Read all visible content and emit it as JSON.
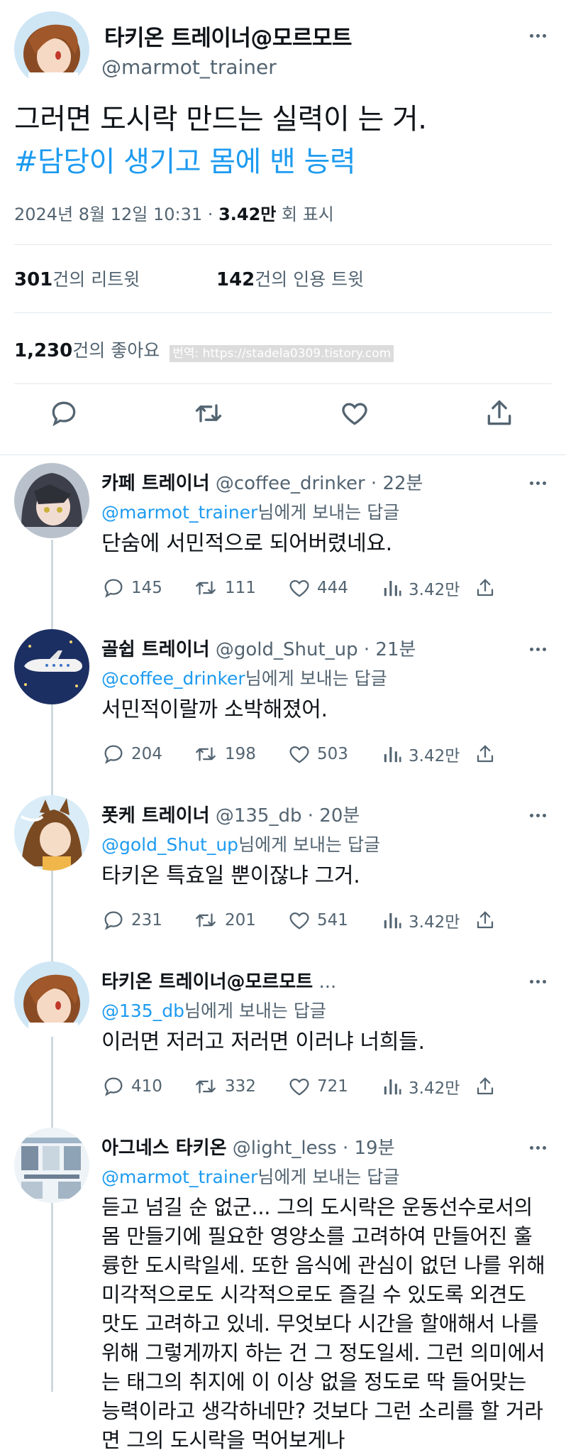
{
  "main": {
    "author_name": "타키온 트레이너@모르모트",
    "author_handle": "@marmot_trainer",
    "text_line1": "그러면 도시락 만드는 실력이 는 거.",
    "hashtag": "#담당이 생기고 몸에 밴 능력",
    "date": "2024년 8월 12일  10:31 · ",
    "views": "3.42만",
    "views_suffix": " 회 표시",
    "retweets": "301",
    "retweets_label": "건의 리트윗",
    "quotes": "142",
    "quotes_label": "건의 인용 트윗",
    "likes": "1,230",
    "likes_label": "건의 좋아요",
    "watermark": "번역: https://stadela0309.tistory.com"
  },
  "replies": [
    {
      "name": "카페 트레이너",
      "handle_time": " @coffee_drinker · 22분",
      "mention": "@marmot_trainer",
      "replyto_suffix": "님에게 보내는 답글",
      "text": "단숨에 서민적으로 되어버렸네요.",
      "reply_count": "145",
      "retweet_count": "111",
      "like_count": "444",
      "view_count": "3.42만"
    },
    {
      "name": "골쉽 트레이너",
      "handle_time": " @gold_Shut_up · 21분",
      "mention": "@coffee_drinker",
      "replyto_suffix": "님에게 보내는 답글",
      "text": "서민적이랄까 소박해졌어.",
      "reply_count": "204",
      "retweet_count": "198",
      "like_count": "503",
      "view_count": "3.42만"
    },
    {
      "name": "폿케 트레이너",
      "handle_time": " @135_db · 20분",
      "mention": "@gold_Shut_up",
      "replyto_suffix": "님에게 보내는 답글",
      "text": "타키온 특효일 뿐이잖냐 그거.",
      "reply_count": "231",
      "retweet_count": "201",
      "like_count": "541",
      "view_count": "3.42만"
    },
    {
      "name": "타키온 트레이너@모르모트",
      "handle_time": " ...",
      "mention": "@135_db",
      "replyto_suffix": "님에게 보내는 답글",
      "text": "이러면 저러고 저러면 이러냐 너희들.",
      "reply_count": "410",
      "retweet_count": "332",
      "like_count": "721",
      "view_count": "3.42만"
    },
    {
      "name": "아그네스 타키온",
      "handle_time": " @light_less · 19분",
      "mention": "@marmot_trainer",
      "replyto_suffix": "님에게 보내는 답글",
      "text": "듣고 넘길 순 없군... 그의 도시락은 운동선수로서의 몸 만들기에 필요한 영양소를 고려하여 만들어진 훌륭한 도시락일세. 또한 음식에 관심이 없던 나를 위해 미각적으로도 시각적으로도 즐길 수 있도록 외견도 맛도 고려하고 있네. 무엇보다 시간을 할애해서 나를 위해 그렇게까지 하는 건 그 정도일세. 그런 의미에서는 태그의 취지에 이 이상 없을 정도로 딱 들어맞는 능력이라고 생각하네만? 것보다 그런 소리를 할 거라면 그의 도시락을 먹어보게나"
    }
  ]
}
